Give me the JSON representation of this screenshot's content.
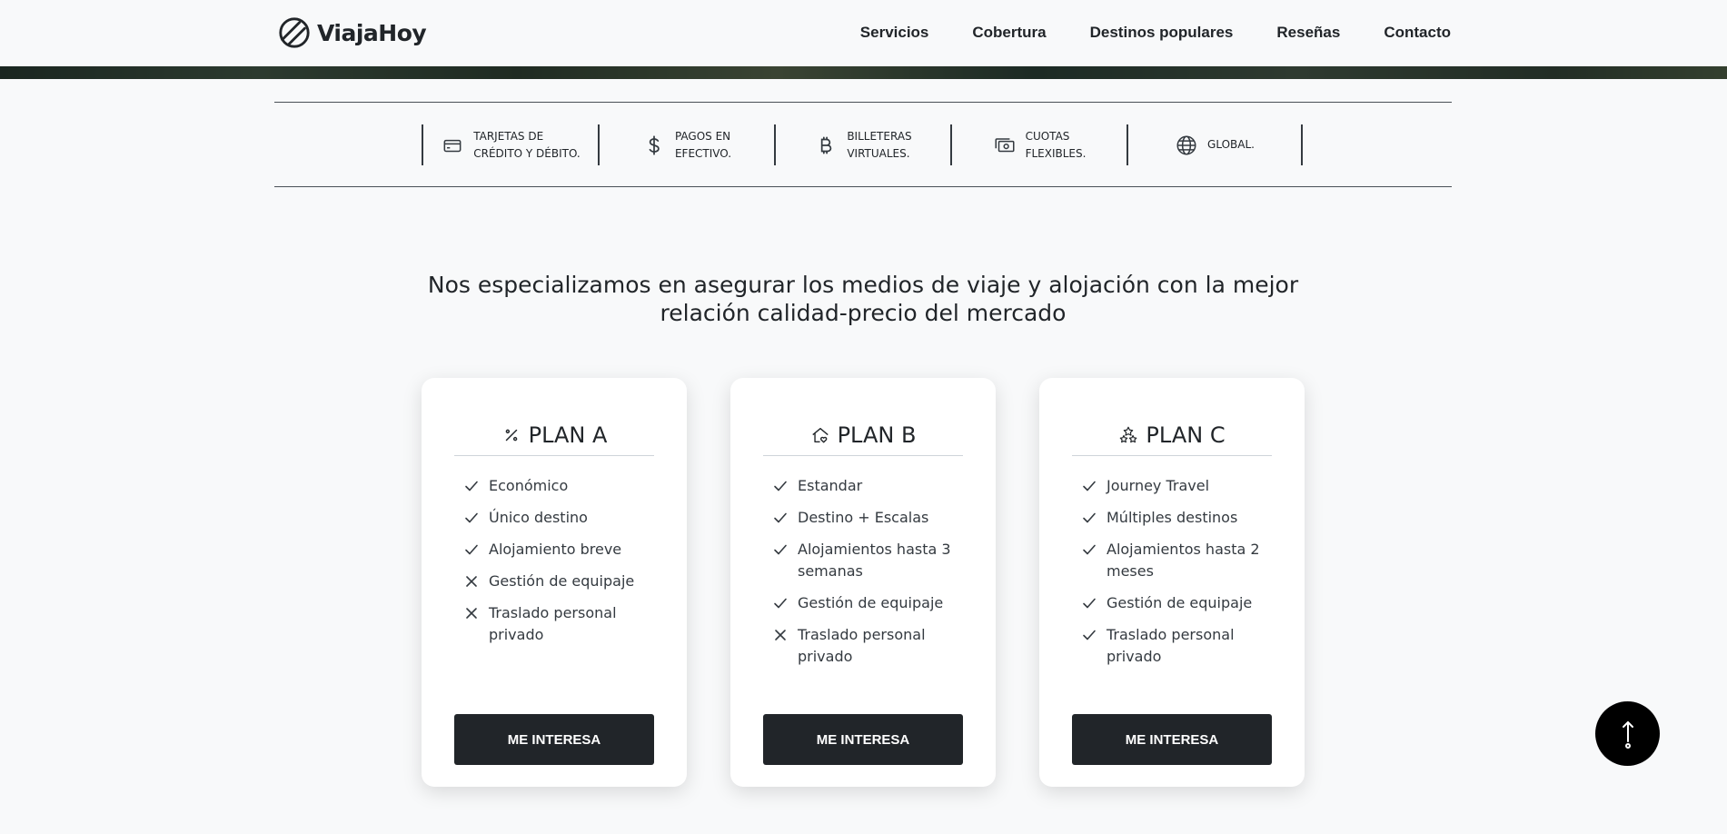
{
  "brand": {
    "name": "ViajaHoy",
    "logo_icon": "circle-slash-logo-icon"
  },
  "nav": {
    "links": [
      "Servicios",
      "Cobertura",
      "Destinos populares",
      "Reseñas",
      "Contacto"
    ]
  },
  "payments": [
    {
      "label": "TARJETAS DE\nCRÉDITO Y DÉBITO.",
      "icon": "credit-card-icon"
    },
    {
      "label": "PAGOS EN\nEFECTIVO.",
      "icon": "dollar-icon"
    },
    {
      "label": "BILLETERAS\nVIRTUALES.",
      "icon": "bitcoin-icon"
    },
    {
      "label": "CUOTAS\nFLEXIBLES.",
      "icon": "cash-stack-icon"
    },
    {
      "label": "GLOBAL.",
      "icon": "globe-icon"
    }
  ],
  "headline": "Nos especializamos en asegurar los medios de viaje y alojación con la mejor relación calidad-precio del mercado",
  "plans": [
    {
      "title": "PLAN A",
      "icon": "percent-icon",
      "features": [
        {
          "text": "Económico",
          "included": true
        },
        {
          "text": "Único destino",
          "included": true
        },
        {
          "text": "Alojamiento breve",
          "included": true
        },
        {
          "text": "Gestión de equipaje",
          "included": false
        },
        {
          "text": "Traslado personal privado",
          "included": false
        }
      ],
      "cta": "ME INTERESA"
    },
    {
      "title": "PLAN B",
      "icon": "house-heart-icon",
      "features": [
        {
          "text": "Estandar",
          "included": true
        },
        {
          "text": "Destino + Escalas",
          "included": true
        },
        {
          "text": "Alojamientos hasta 3 semanas",
          "included": true
        },
        {
          "text": "Gestión de equipaje",
          "included": true
        },
        {
          "text": "Traslado personal privado",
          "included": false
        }
      ],
      "cta": "ME INTERESA"
    },
    {
      "title": "PLAN C",
      "icon": "stars-icon",
      "features": [
        {
          "text": "Journey Travel",
          "included": true
        },
        {
          "text": "Múltiples destinos",
          "included": true
        },
        {
          "text": "Alojamientos hasta 2 meses",
          "included": true
        },
        {
          "text": "Gestión de equipaje",
          "included": true
        },
        {
          "text": "Traslado personal privado",
          "included": true
        }
      ],
      "cta": "ME INTERESA"
    }
  ],
  "back_to_top_icon": "arrow-up-icon"
}
